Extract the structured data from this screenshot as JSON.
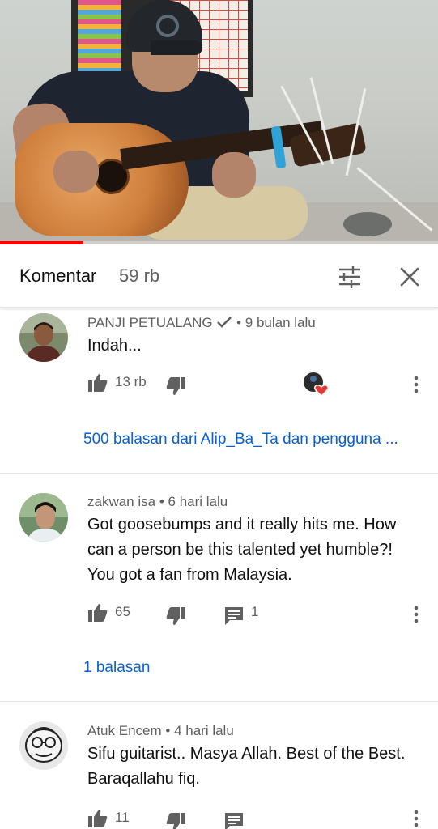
{
  "video": {
    "progress_fraction": 0.19
  },
  "comments_header": {
    "title": "Komentar",
    "count": "59 rb",
    "filter_icon": "sort-filter-icon",
    "close_icon": "close-icon"
  },
  "comments": [
    {
      "author": "PANJI PETUALANG",
      "verified": true,
      "time": "• 9 bulan lalu",
      "text": "Indah...",
      "likes": "13 rb",
      "reply_count": "",
      "creator_hearted": true,
      "replies_link": "500 balasan dari Alip_Ba_Ta dan pengguna ..."
    },
    {
      "author": "zakwan isa",
      "verified": false,
      "time": "• 6 hari lalu",
      "text": "Got goosebumps and it really hits me. How can a person be this talented yet humble?! You got a fan from Malaysia.",
      "likes": "65",
      "reply_count": "1",
      "creator_hearted": false,
      "replies_link": "1 balasan"
    },
    {
      "author": "Atuk Encem",
      "verified": false,
      "time": "• 4 hari lalu",
      "text": "Sifu guitarist.. Masya Allah.  Best of the Best. Baraqallahu fiq.",
      "likes": "11",
      "reply_count": "",
      "creator_hearted": false,
      "replies_link": ""
    }
  ],
  "colors": {
    "link": "#065fd4",
    "progress": "#ff0000",
    "heart": "#e53935",
    "meta": "#606060"
  }
}
